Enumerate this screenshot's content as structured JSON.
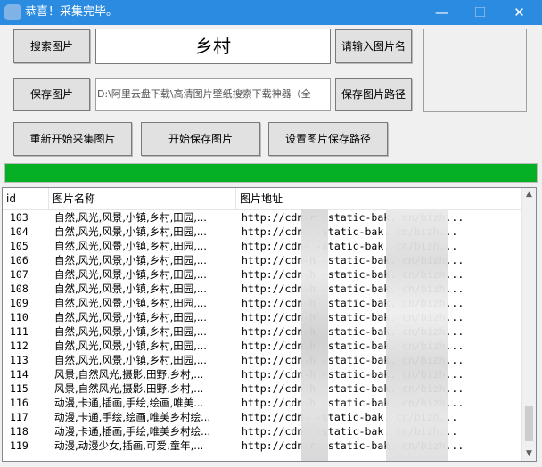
{
  "window": {
    "title": "恭喜！采集完毕。",
    "controls": [
      "—",
      "☐",
      "✕"
    ]
  },
  "toolbar": {
    "search_button": "搜索图片",
    "search_value": "乡村",
    "name_hint_button": "请输入图片名",
    "save_button": "保存图片",
    "save_path": "D:\\阿里云盘下载\\高清图片壁纸搜索下载神器（全",
    "save_path_button": "保存图片路径",
    "restart_button": "重新开始采集图片",
    "start_save_button": "开始保存图片",
    "set_path_button": "设置图片保存路径"
  },
  "progress": {
    "percent": 100,
    "color": "#06b025"
  },
  "list": {
    "columns": [
      "id",
      "图片名称",
      "图片地址"
    ],
    "rows": [
      {
        "id": "103",
        "name": "自然,风光,风景,小镇,乡村,田园,...",
        "url": "http://cdn-r  -static-bak.        cn/bizh..."
      },
      {
        "id": "104",
        "name": "自然,风光,风景,小镇,乡村,田园,...",
        "url": "http://cdn-   -static-bak.        cn/bizh..."
      },
      {
        "id": "105",
        "name": "自然,风光,风景,小镇,乡村,田园,...",
        "url": "http://cdn-   -static-bak.        cn/bizh..."
      },
      {
        "id": "106",
        "name": "自然,风光,风景,小镇,乡村,田园,...",
        "url": "http://cdn-h  -static-bak.        cn/bizh..."
      },
      {
        "id": "107",
        "name": "自然,风光,风景,小镇,乡村,田园,...",
        "url": "http://cdn-h  -static-bak.        cn/bizh..."
      },
      {
        "id": "108",
        "name": "自然,风光,风景,小镇,乡村,田园,...",
        "url": "http://cdn-h  -static-bak.        cn/bizh..."
      },
      {
        "id": "109",
        "name": "自然,风光,风景,小镇,乡村,田园,...",
        "url": "http://cdn-h  -static-bak.        cn/bizh..."
      },
      {
        "id": "110",
        "name": "自然,风光,风景,小镇,乡村,田园,...",
        "url": "http://cdn-h  -static-bak.        cn/bizh..."
      },
      {
        "id": "111",
        "name": "自然,风光,风景,小镇,乡村,田园,...",
        "url": "http://cdn-h  -static-bak.        cn/bizh..."
      },
      {
        "id": "112",
        "name": "自然,风光,风景,小镇,乡村,田园,...",
        "url": "http://cdn-h  -static-bak.        cn/bizh..."
      },
      {
        "id": "113",
        "name": "自然,风光,风景,小镇,乡村,田园,...",
        "url": "http://cdn-h  -static-bak.        cn/bizh..."
      },
      {
        "id": "114",
        "name": "风景,自然风光,摄影,田野,乡村,...",
        "url": "http://cdn-h  -static-bak.        cn/bizh..."
      },
      {
        "id": "115",
        "name": "风景,自然风光,摄影,田野,乡村,...",
        "url": "http://cdn-h  -static-bak.        cn/bizh..."
      },
      {
        "id": "116",
        "name": "动漫,卡通,插画,手绘,绘画,唯美...",
        "url": "http://cdn-h  -static-bak.        cn/bizh..."
      },
      {
        "id": "117",
        "name": "动漫,卡通,手绘,绘画,唯美乡村绘...",
        "url": "http://cdn-   -static-bak.        cn/bizh..."
      },
      {
        "id": "118",
        "name": "动漫,卡通,插画,手绘,唯美乡村绘...",
        "url": "http://cdn-   -static-bak.        cn/bizh..."
      },
      {
        "id": "119",
        "name": "动漫,动漫少女,插画,可爱,童年,...",
        "url": "http://cdn-r  -static-bak.        cn/bizh..."
      }
    ]
  },
  "scrollbar": {
    "up_icon": "▲",
    "down_icon": "▼"
  }
}
